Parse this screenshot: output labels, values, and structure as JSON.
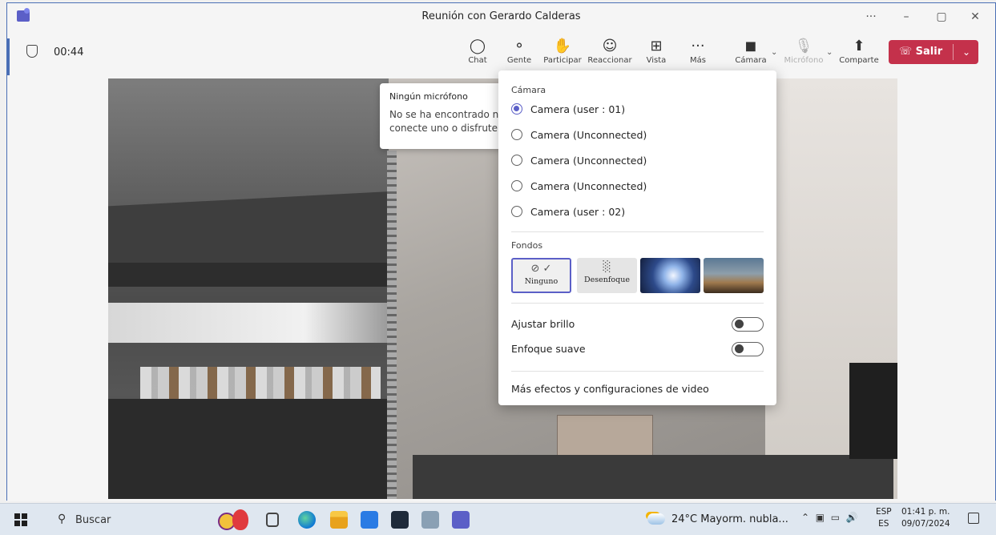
{
  "window": {
    "title": "Reunión con Gerardo Calderas",
    "controls": {
      "more": "···",
      "minimize": "–",
      "maximize": "▢",
      "close": "✕"
    }
  },
  "meeting": {
    "timer": "00:44",
    "toolbar": [
      {
        "key": "chat",
        "label": "Chat",
        "icon": "chat-icon"
      },
      {
        "key": "people",
        "label": "Gente",
        "icon": "people-icon"
      },
      {
        "key": "raise-hand",
        "label": "Participar",
        "icon": "raise-hand-icon"
      },
      {
        "key": "react",
        "label": "Reaccionar",
        "icon": "smiley-icon"
      },
      {
        "key": "view",
        "label": "Vista",
        "icon": "grid-icon"
      },
      {
        "key": "more",
        "label": "Más",
        "icon": "more-icon"
      },
      {
        "key": "camera",
        "label": "Cámara",
        "icon": "camera-icon"
      },
      {
        "key": "mic",
        "label": "Micrófono",
        "icon": "microphone-icon",
        "disabled": true
      },
      {
        "key": "share",
        "label": "Comparte",
        "icon": "share-icon"
      }
    ],
    "leave_label": "Salir",
    "leave_color": "#c4314b"
  },
  "tooltip": {
    "title": "Ningún micrófono",
    "line1": "No se ha encontrado nin",
    "line2": "conecte uno o disfrute e"
  },
  "camera_menu": {
    "camera_section": "Cámara",
    "cameras": [
      {
        "label": "Camera (user : 01)",
        "selected": true
      },
      {
        "label": "Camera (Unconnected)",
        "selected": false
      },
      {
        "label": "Camera (Unconnected)",
        "selected": false
      },
      {
        "label": "Camera (Unconnected)",
        "selected": false
      },
      {
        "label": "Camera (user : 02)",
        "selected": false
      }
    ],
    "backgrounds_section": "Fondos",
    "backgrounds": [
      {
        "label": "Ninguno",
        "selected": true
      },
      {
        "label": "Desenfoque",
        "selected": false
      },
      {
        "label": "",
        "selected": false
      },
      {
        "label": "",
        "selected": false
      }
    ],
    "adjust_brightness": {
      "label": "Ajustar brillo",
      "on": false
    },
    "soft_focus": {
      "label": "Enfoque suave",
      "on": false
    },
    "more_effects": "Más efectos y configuraciones de video",
    "accent_color": "#5b5fc7"
  },
  "taskbar": {
    "search_label": "Buscar",
    "weather": "24°C  Mayorm. nubla...",
    "lang_top": "ESP",
    "lang_bottom": "ES",
    "time": "01:41 p. m.",
    "date": "09/07/2024"
  }
}
